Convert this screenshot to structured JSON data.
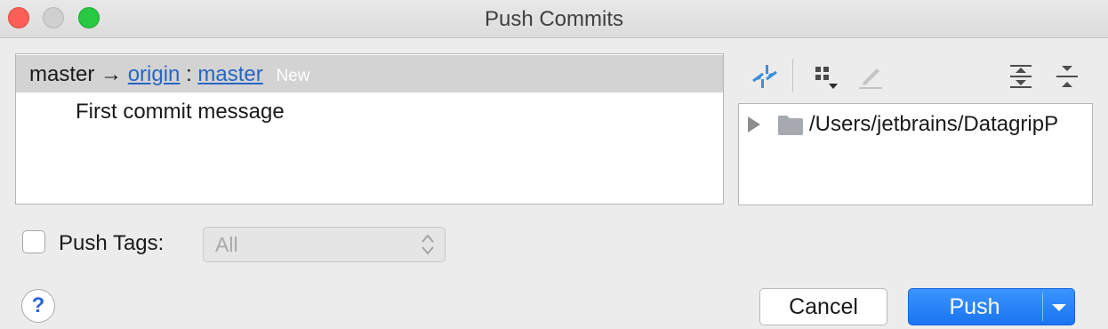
{
  "window": {
    "title": "Push Commits"
  },
  "commits": {
    "branch": {
      "local": "master",
      "arrow": "→",
      "remote": "origin",
      "colon": ":",
      "remote_branch": "master",
      "badge": "New"
    },
    "items": [
      {
        "message": "First commit message"
      }
    ]
  },
  "toolbar": {
    "icons": [
      "fetch-icon",
      "group-by-icon",
      "edit-icon",
      "expand-all-icon",
      "collapse-all-icon"
    ]
  },
  "tree": {
    "root": {
      "path": "/Users/jetbrains/DatagripP"
    }
  },
  "push_tags": {
    "label": "Push Tags:",
    "checked": false,
    "select_value": "All"
  },
  "buttons": {
    "help": "?",
    "cancel": "Cancel",
    "push": "Push"
  },
  "colors": {
    "accent": "#1a74f1",
    "link": "#2765c4",
    "selection": "#d3d3d3"
  }
}
